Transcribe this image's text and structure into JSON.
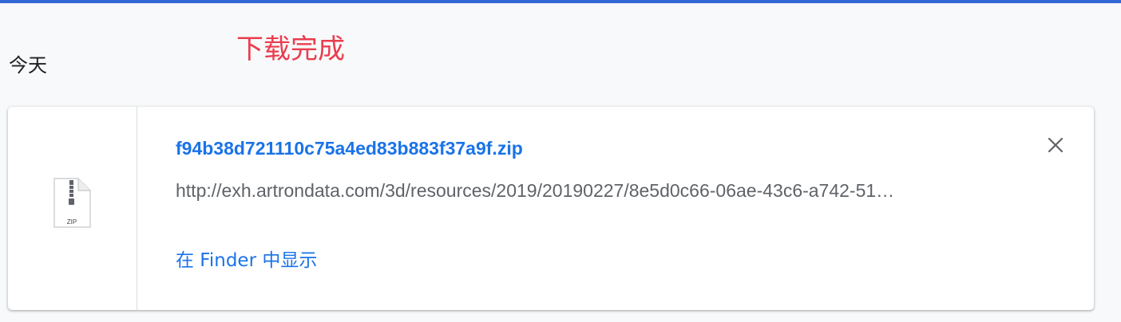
{
  "header": {
    "annotation": "下载完成",
    "date_heading": "今天"
  },
  "download_item": {
    "file_name": "f94b38d721110c75a4ed83b883f37a9f.zip",
    "url": "http://exh.artrondata.com/3d/resources/2019/20190227/8e5d0c66-06ae-43c6-a742-51…",
    "file_type_label": "ZIP",
    "show_in_finder_label": "在 Finder 中显示",
    "close_icon": "close-icon",
    "file_icon": "zip-file-icon"
  },
  "colors": {
    "top_bar": "#3367d6",
    "annotation": "#ea3d4e",
    "link": "#1a73e8",
    "secondary_text": "#5f6368"
  }
}
